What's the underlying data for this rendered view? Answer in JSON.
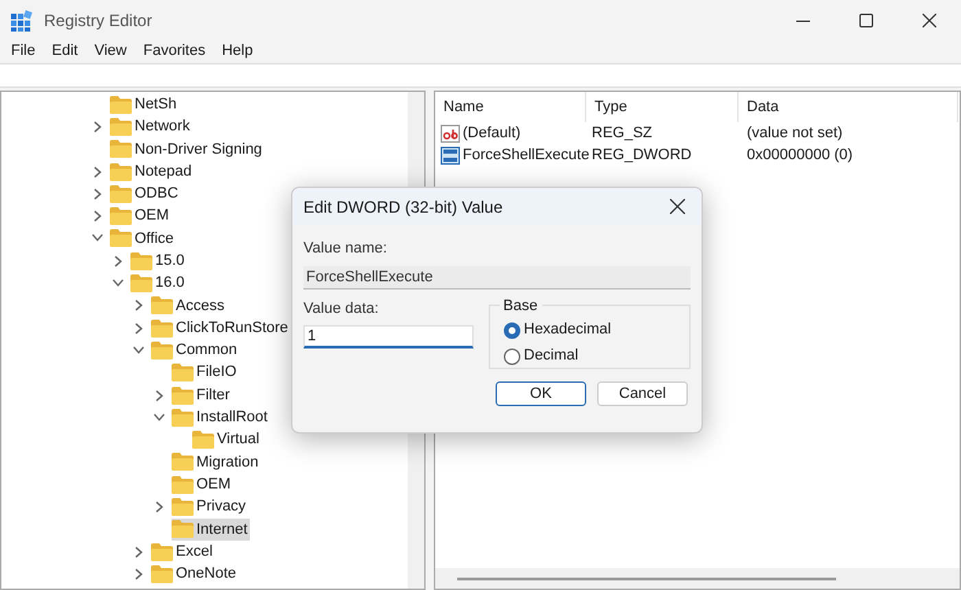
{
  "window": {
    "title": "Registry Editor"
  },
  "menu": [
    "File",
    "Edit",
    "View",
    "Favorites",
    "Help"
  ],
  "tree": [
    {
      "label": "NetSh",
      "kind": "leaf",
      "selected": false
    },
    {
      "label": "Network",
      "kind": "branch",
      "expanded": false,
      "selected": false
    },
    {
      "label": "Non-Driver Signing",
      "kind": "leaf",
      "selected": false
    },
    {
      "label": "Notepad",
      "kind": "branch",
      "expanded": false,
      "selected": false
    },
    {
      "label": "ODBC",
      "kind": "branch",
      "expanded": false,
      "selected": false
    },
    {
      "label": "OEM",
      "kind": "branch",
      "expanded": false,
      "selected": false
    },
    {
      "label": "Office",
      "kind": "branch",
      "expanded": true,
      "selected": false,
      "children": [
        {
          "label": "15.0",
          "kind": "branch",
          "expanded": false,
          "selected": false
        },
        {
          "label": "16.0",
          "kind": "branch",
          "expanded": true,
          "selected": false,
          "children": [
            {
              "label": "Access",
              "kind": "branch",
              "expanded": false,
              "selected": false
            },
            {
              "label": "ClickToRunStore",
              "kind": "branch",
              "expanded": false,
              "selected": false
            },
            {
              "label": "Common",
              "kind": "branch",
              "expanded": true,
              "selected": false,
              "children": [
                {
                  "label": "FileIO",
                  "kind": "leaf",
                  "selected": false
                },
                {
                  "label": "Filter",
                  "kind": "branch",
                  "expanded": false,
                  "selected": false
                },
                {
                  "label": "InstallRoot",
                  "kind": "branch",
                  "expanded": true,
                  "selected": false,
                  "children": [
                    {
                      "label": "Virtual",
                      "kind": "leaf",
                      "selected": false
                    }
                  ]
                },
                {
                  "label": "Migration",
                  "kind": "leaf",
                  "selected": false
                },
                {
                  "label": "OEM",
                  "kind": "leaf",
                  "selected": false
                },
                {
                  "label": "Privacy",
                  "kind": "branch",
                  "expanded": false,
                  "selected": false
                },
                {
                  "label": "Internet",
                  "kind": "leaf",
                  "selected": true
                }
              ]
            },
            {
              "label": "Excel",
              "kind": "branch",
              "expanded": false,
              "selected": false
            },
            {
              "label": "OneNote",
              "kind": "branch",
              "expanded": false,
              "selected": false
            }
          ]
        }
      ]
    }
  ],
  "values": {
    "columns": [
      "Name",
      "Type",
      "Data"
    ],
    "rows": [
      {
        "kind": "string",
        "name": "(Default)",
        "type": "REG_SZ",
        "data": "(value not set)"
      },
      {
        "kind": "binary",
        "name": "ForceShellExecute",
        "type": "REG_DWORD",
        "data": "0x00000000 (0)"
      }
    ]
  },
  "dialog": {
    "title": "Edit DWORD (32-bit) Value",
    "name_label": "Value name:",
    "name_value": "ForceShellExecute",
    "data_label": "Value data:",
    "data_value": "1",
    "base_label": "Base",
    "bases": [
      {
        "label": "Hexadecimal",
        "selected": true
      },
      {
        "label": "Decimal",
        "selected": false
      }
    ],
    "buttons": [
      {
        "label": "OK",
        "kind": "default"
      },
      {
        "label": "Cancel",
        "kind": "normal"
      }
    ]
  }
}
